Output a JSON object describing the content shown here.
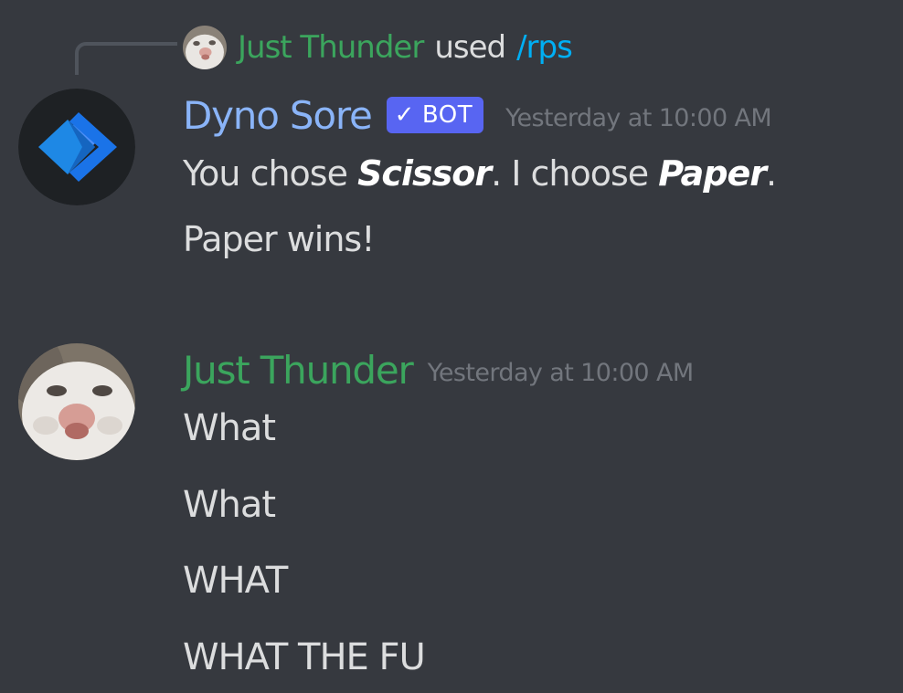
{
  "interaction": {
    "user": "Just Thunder",
    "verb": "used",
    "command": "/rps"
  },
  "bot_message": {
    "author": "Dyno Sore",
    "tag_check": "✓",
    "tag": "BOT",
    "timestamp": "Yesterday at 10:00 AM",
    "line1_prefix": "You chose ",
    "line1_user_choice": "Scissor",
    "line1_middle": ". I choose ",
    "line1_bot_choice": "Paper",
    "line1_suffix": ".",
    "line2": "Paper wins!"
  },
  "user_message": {
    "author": "Just Thunder",
    "timestamp": "Yesterday at 10:00 AM",
    "lines": [
      "What",
      "What",
      "WHAT",
      "WHAT THE FU"
    ]
  },
  "colors": {
    "background": "#36393f",
    "bot_name": "#8ab4f8",
    "user_name": "#3ba55d",
    "command": "#00aff4",
    "bot_tag": "#5865f2",
    "timestamp": "#72767d",
    "text": "#dcddde"
  },
  "icons": {
    "bot_avatar": "dyno-chevron-logo",
    "user_avatar": "cat-face-photo",
    "tag_check": "check-icon"
  }
}
